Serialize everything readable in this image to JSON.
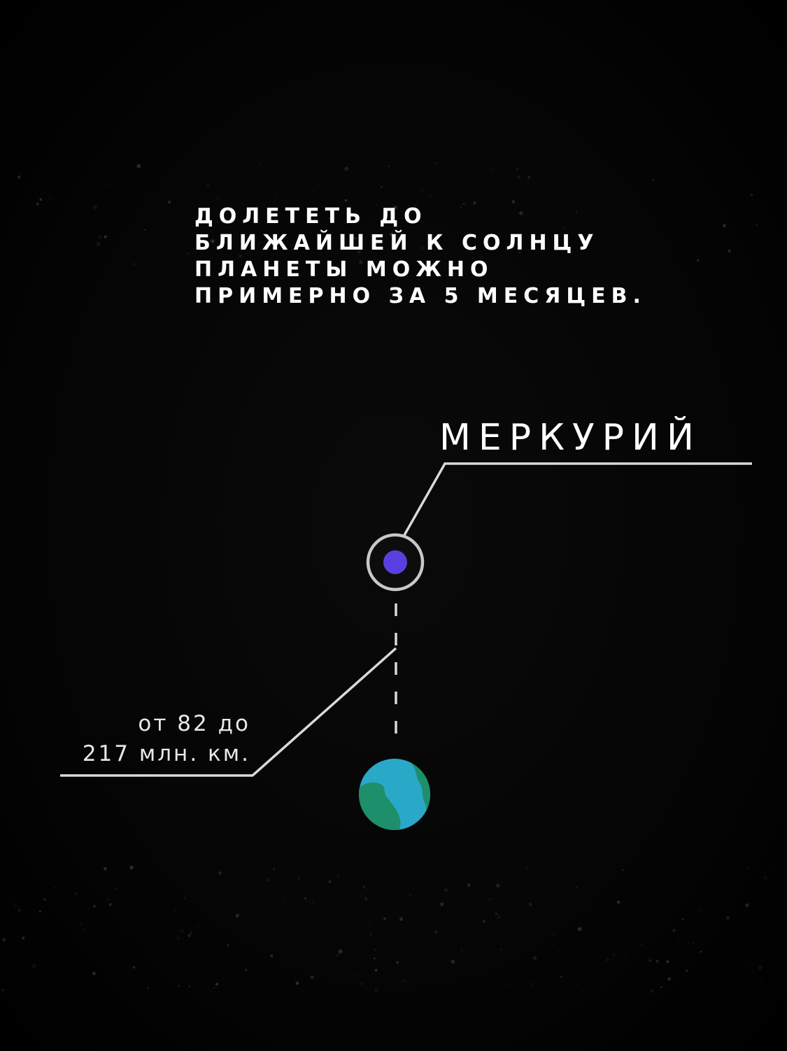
{
  "headline": {
    "lines": [
      "ДОЛЕТЕТЬ ДО",
      "БЛИЖАЙШЕЙ К СОЛНЦУ",
      "ПЛАНЕТЫ МОЖНО",
      "ПРИМЕРНО ЗА 5 МЕСЯЦЕВ."
    ]
  },
  "planet": {
    "name": "МЕРКУРИЙ",
    "color": "#5a3fe0",
    "ring_color": "#c8c8c8"
  },
  "distance": {
    "lines": [
      "от 82 до",
      "217 млн. км."
    ]
  },
  "earth": {
    "ocean_color": "#2aa8c8",
    "land_color": "#1d8f6a"
  },
  "colors": {
    "background": "#000000",
    "text": "#ffffff",
    "lines": "#d9d9d9"
  }
}
